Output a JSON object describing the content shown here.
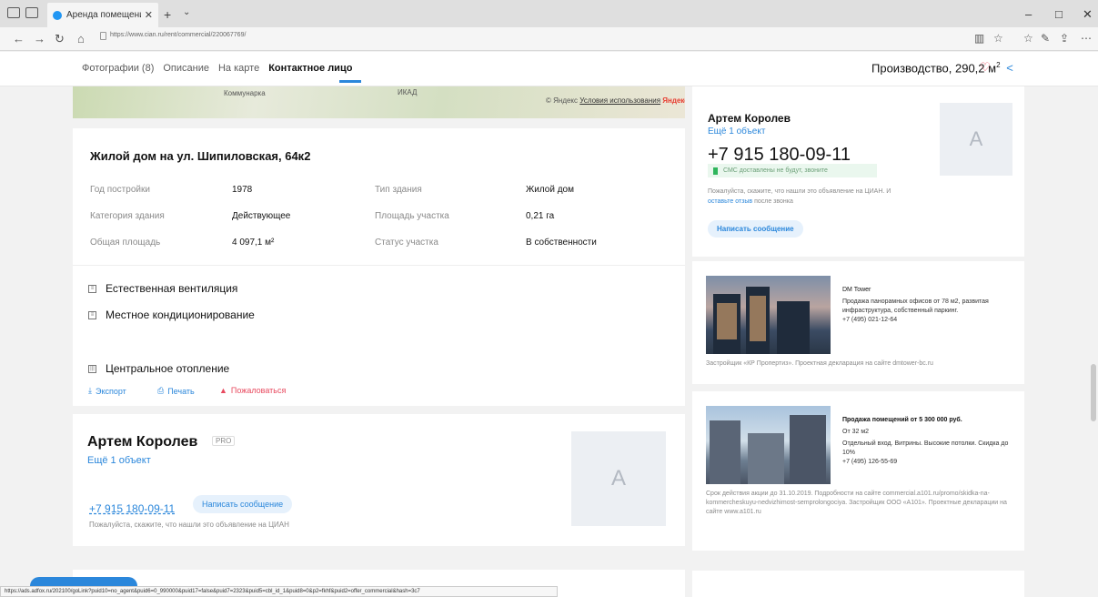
{
  "browser": {
    "tab_title": "Аренда помещения по",
    "tab_close": "✕",
    "new_tab": "+",
    "tab_dropdown": "⌄",
    "url": "https://www.cian.ru/rent/commercial/220067769/",
    "win_min": "–",
    "win_max": "□",
    "win_close": "✕"
  },
  "sitenav": {
    "links": [
      "Фотографии (8)",
      "Описание",
      "На карте",
      "Контактное лицо"
    ],
    "title": "Производство, 290,2 м",
    "title_sup": "2"
  },
  "map": {
    "place_1": "Коммунарка",
    "place_2": "ИКАД",
    "copyright": "© Яндекс",
    "terms_link": "Условия использования",
    "logo": "Яндекс"
  },
  "building": {
    "title": "Жилой дом на ул. Шипиловская, 64к2",
    "rows": [
      {
        "k1": "Год постройки",
        "v1": "1978",
        "k2": "Тип здания",
        "v2": "Жилой дом"
      },
      {
        "k1": "Категория здания",
        "v1": "Действующее",
        "k2": "Площадь участка",
        "v2": "0,21 га"
      },
      {
        "k1": "Общая площадь",
        "v1": "4 097,1 м²",
        "k2": "Статус участка",
        "v2": "В собственности"
      }
    ]
  },
  "features": [
    "Естественная вентиляция",
    "Местное кондиционирование",
    "Центральное отопление"
  ],
  "actions": {
    "export": "Экспорт",
    "print": "Печать",
    "complain": "Пожаловаться"
  },
  "agent": {
    "name": "Артем Королев",
    "pro": "PRO",
    "more": "Ещё 1 объект",
    "phone": "+7 915 180-09-11",
    "write": "Написать сообщение",
    "hint": "Пожалуйста, скажите, что нашли это объявление на ЦИАН",
    "avatar_letter": "A"
  },
  "contact": {
    "name": "Артем Королев",
    "more": "Ещё 1 объект",
    "avatar_letter": "A",
    "phone": "+7 915 180-09-11",
    "sms": "СМС доставлены не будут, звоните",
    "note_1": "Пожалуйста, скажите, что нашли это объявление на ЦИАН. И",
    "note_link": "оставьте отзыв",
    "note_2": "после звонка",
    "write": "Написать сообщение"
  },
  "ad1": {
    "title": "DM Tower",
    "body": "Продажа панорамных офисов от 78 м2, развитая инфраструктура, собственный паркинг.",
    "phone": "+7 (495) 021-12-64",
    "footer": "Застройщик «КР Пропертиз». Проектная декларация на сайте dmtower-bc.ru"
  },
  "ad2": {
    "title": "Продажа помещений от 5 300 000 руб.",
    "subtitle": "От 32 м2",
    "body": "Отдельный вход. Витрины. Высокие потолки. Скидка до 10%",
    "phone": "+7 (495) 126-55-69",
    "footer": "Срок действия акции до 31.10.2019. Подробности на сайте commercial.a101.ru/promo/skidka-na-kommercheskuyu-nedvizhimost-semprolongociya. Застройщик ООО «А101». Проектные декларации на сайте www.a101.ru"
  },
  "statusbar": {
    "text": "https://ads.adfox.ru/202100/goLink?puid10=no_agent&puid6=0_990000&puid17=false&puid7=2323&puid5=cbl_id_1&puid8=0&p2=fkhf&puid2=offer_commercial&hash=3c7"
  },
  "colors": {
    "accent": "#2b87db",
    "heart": "#e84a5f",
    "complain": "#e84a5f",
    "sms_bg": "#eaf7ee"
  }
}
